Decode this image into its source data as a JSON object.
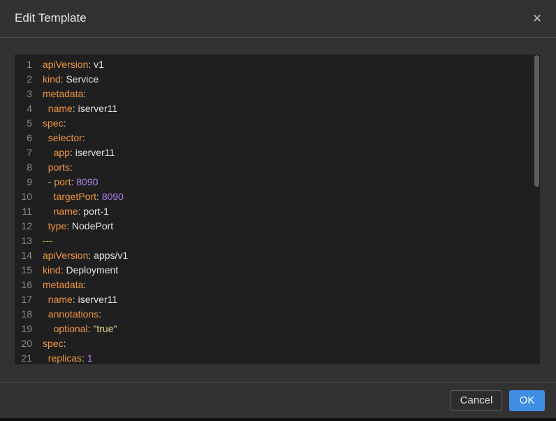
{
  "dialog": {
    "title": "Edit Template",
    "close_icon": "close-icon",
    "close_glyph": "×"
  },
  "editor": {
    "lines": [
      {
        "n": 1,
        "tokens": [
          {
            "key": "apiVersion"
          },
          {
            "punct": ": "
          },
          {
            "value": "v1"
          }
        ]
      },
      {
        "n": 2,
        "tokens": [
          {
            "key": "kind"
          },
          {
            "punct": ": "
          },
          {
            "value": "Service"
          }
        ]
      },
      {
        "n": 3,
        "tokens": [
          {
            "key": "metadata"
          },
          {
            "punct": ":"
          }
        ]
      },
      {
        "n": 4,
        "tokens": [
          {
            "space": "  "
          },
          {
            "key": "name"
          },
          {
            "punct": ": "
          },
          {
            "value": "iserver11"
          }
        ]
      },
      {
        "n": 5,
        "tokens": [
          {
            "key": "spec"
          },
          {
            "punct": ":"
          }
        ]
      },
      {
        "n": 6,
        "tokens": [
          {
            "space": "  "
          },
          {
            "key": "selector"
          },
          {
            "punct": ":"
          }
        ]
      },
      {
        "n": 7,
        "tokens": [
          {
            "space": "    "
          },
          {
            "key": "app"
          },
          {
            "punct": ": "
          },
          {
            "value": "iserver11"
          }
        ]
      },
      {
        "n": 8,
        "tokens": [
          {
            "space": "  "
          },
          {
            "key": "ports"
          },
          {
            "punct": ":"
          }
        ]
      },
      {
        "n": 9,
        "tokens": [
          {
            "space": "  "
          },
          {
            "punct": "- "
          },
          {
            "key": "port"
          },
          {
            "punct": ": "
          },
          {
            "number": "8090"
          }
        ]
      },
      {
        "n": 10,
        "tokens": [
          {
            "space": "    "
          },
          {
            "key": "targetPort"
          },
          {
            "punct": ": "
          },
          {
            "number": "8090"
          }
        ]
      },
      {
        "n": 11,
        "tokens": [
          {
            "space": "    "
          },
          {
            "key": "name"
          },
          {
            "punct": ": "
          },
          {
            "value": "port-1"
          }
        ]
      },
      {
        "n": 12,
        "tokens": [
          {
            "space": "  "
          },
          {
            "key": "type"
          },
          {
            "punct": ": "
          },
          {
            "value": "NodePort"
          }
        ]
      },
      {
        "n": 13,
        "tokens": [
          {
            "separator": "---"
          }
        ]
      },
      {
        "n": 14,
        "tokens": [
          {
            "key": "apiVersion"
          },
          {
            "punct": ": "
          },
          {
            "value": "apps/v1"
          }
        ]
      },
      {
        "n": 15,
        "tokens": [
          {
            "key": "kind"
          },
          {
            "punct": ": "
          },
          {
            "value": "Deployment"
          }
        ]
      },
      {
        "n": 16,
        "tokens": [
          {
            "key": "metadata"
          },
          {
            "punct": ":"
          }
        ]
      },
      {
        "n": 17,
        "tokens": [
          {
            "space": "  "
          },
          {
            "key": "name"
          },
          {
            "punct": ": "
          },
          {
            "value": "iserver11"
          }
        ]
      },
      {
        "n": 18,
        "tokens": [
          {
            "space": "  "
          },
          {
            "key": "annotations"
          },
          {
            "punct": ":"
          }
        ]
      },
      {
        "n": 19,
        "tokens": [
          {
            "space": "    "
          },
          {
            "key": "optional"
          },
          {
            "punct": ": "
          },
          {
            "string": "\"true\""
          }
        ]
      },
      {
        "n": 20,
        "tokens": [
          {
            "key": "spec"
          },
          {
            "punct": ":"
          }
        ]
      },
      {
        "n": 21,
        "tokens": [
          {
            "space": "  "
          },
          {
            "key": "replicas"
          },
          {
            "punct": ": "
          },
          {
            "number": "1"
          }
        ]
      }
    ]
  },
  "footer": {
    "cancel_label": "Cancel",
    "ok_label": "OK"
  },
  "colors": {
    "key": "#f0963f",
    "punct": "#d4d4d4",
    "value": "#e2e2e2",
    "number": "#b083f0",
    "string": "#e6d98a",
    "separator": "#cbb452",
    "linenum": "#8a8a8a",
    "dialog": "#323232",
    "editor": "#1f1f1f",
    "accent": "#3e8ee4"
  }
}
